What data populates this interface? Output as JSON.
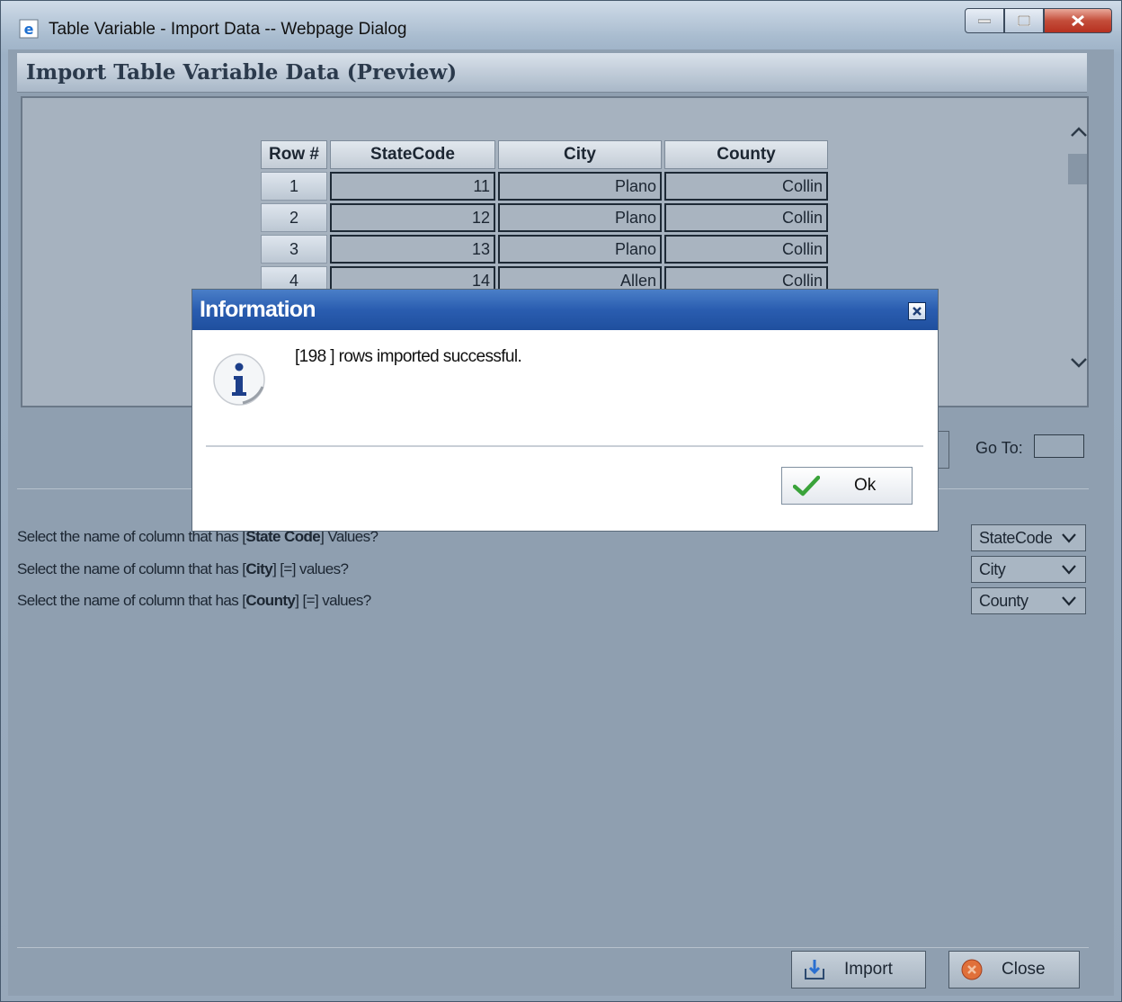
{
  "window": {
    "title": "Table Variable - Import Data -- Webpage Dialog"
  },
  "header": {
    "title": "Import Table Variable Data (Preview)"
  },
  "grid": {
    "columns": [
      "Row #",
      "StateCode",
      "City",
      "County"
    ],
    "rows": [
      {
        "row": "1",
        "statecode": "11",
        "city": "Plano",
        "county": "Collin"
      },
      {
        "row": "2",
        "statecode": "12",
        "city": "Plano",
        "county": "Collin"
      },
      {
        "row": "3",
        "statecode": "13",
        "city": "Plano",
        "county": "Collin"
      },
      {
        "row": "4",
        "statecode": "14",
        "city": "Allen",
        "county": "Collin"
      }
    ]
  },
  "pager": {
    "goto_label": "Go To:",
    "goto_value": ""
  },
  "mapping": {
    "questions": [
      {
        "prefix": "Select the name of column that has [",
        "field": "State Code",
        "suffix": "] Values?",
        "selected": "StateCode"
      },
      {
        "prefix": "Select the name of column that has [",
        "field": "City",
        "suffix": "] [=] values?",
        "selected": "City"
      },
      {
        "prefix": "Select the name of column that has [",
        "field": "County",
        "suffix": "] [=] values?",
        "selected": "County"
      }
    ]
  },
  "footer": {
    "import_label": "Import",
    "close_label": "Close"
  },
  "dialog": {
    "title": "Information",
    "message": "[198 ] rows imported successful.",
    "ok_label": "Ok"
  },
  "colors": {
    "dialog_title_bar": "#2a5db0",
    "window_close": "#c44d3a",
    "content_bg": "#8f9fb0"
  },
  "icons": [
    "ie-icon",
    "minimize-icon",
    "maximize-icon",
    "close-icon",
    "scroll-up-icon",
    "scroll-down-icon",
    "chevron-down-icon",
    "import-icon",
    "close-circle-icon",
    "info-icon",
    "checkmark-icon"
  ]
}
